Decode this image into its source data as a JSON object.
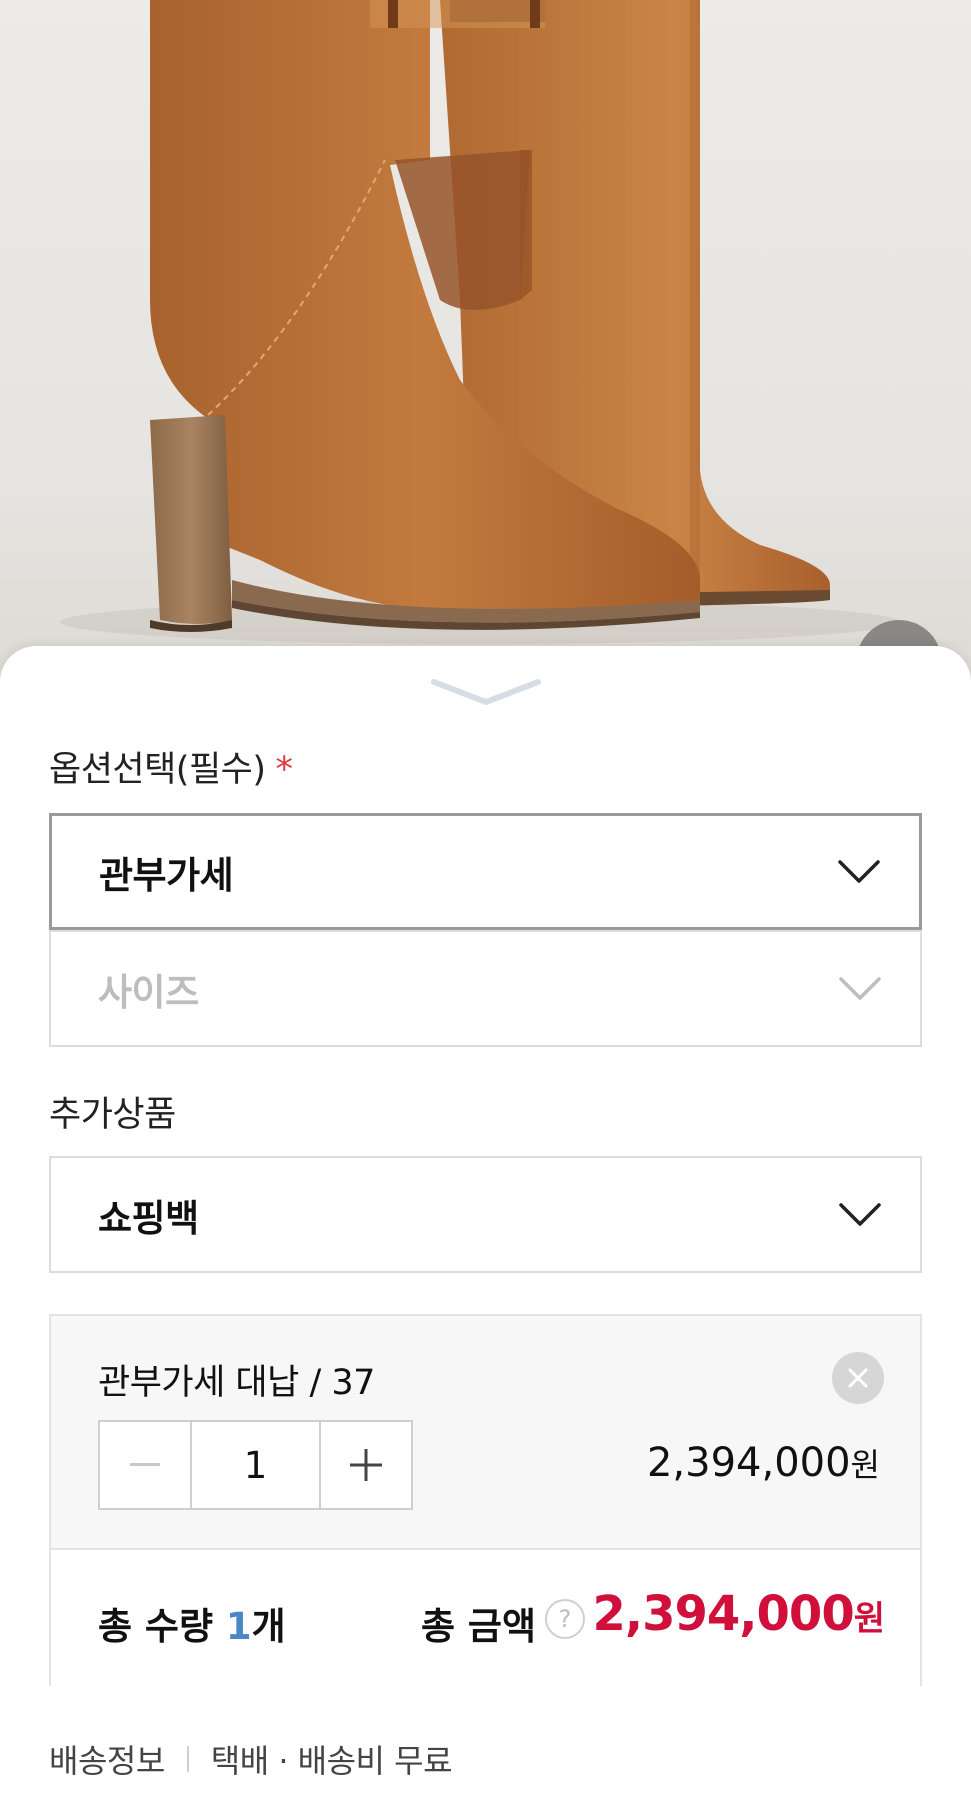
{
  "options_section": {
    "label": "옵션선택(필수)",
    "required_mark": "*",
    "select_1_value": "관부가세",
    "select_2_placeholder": "사이즈"
  },
  "addon_section": {
    "label": "추가상품",
    "select_value": "쇼핑백"
  },
  "selected_option": {
    "name": "관부가세 대납 / 37",
    "quantity": "1",
    "price": "2,394,000",
    "currency": "원"
  },
  "totals": {
    "qty_prefix": "총 수량 ",
    "qty_value": "1",
    "qty_suffix": "개",
    "amount_label": "총 금액",
    "help_glyph": "?",
    "amount_value": "2,394,000",
    "currency": "원"
  },
  "shipping": {
    "label": "배송정보",
    "detail": "택배 · 배송비 무료"
  },
  "colors": {
    "accent_red": "#d0103a",
    "qty_blue": "#4a86c8",
    "required_star": "#e0393f"
  },
  "icons": [
    "chevron-down-icon",
    "close-icon",
    "minus-icon",
    "plus-icon",
    "help-icon",
    "sheet-handle-icon"
  ]
}
